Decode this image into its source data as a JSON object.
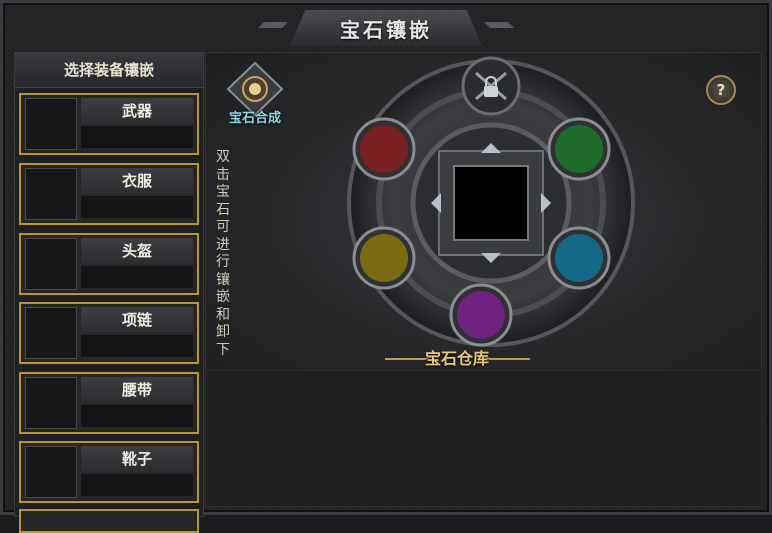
{
  "window": {
    "title": "宝石镶嵌"
  },
  "equipment": {
    "header": "选择装备镶嵌",
    "slots": [
      {
        "label": "武器"
      },
      {
        "label": "衣服"
      },
      {
        "label": "头盔"
      },
      {
        "label": "项链"
      },
      {
        "label": "腰带"
      },
      {
        "label": "靴子"
      }
    ]
  },
  "tools": {
    "synthesis_label": "宝石合成",
    "synthesis_icon": "gem-synthesis-icon",
    "help_label": "?"
  },
  "instructions": "双击宝石可进行镶嵌和卸下",
  "wheel": {
    "sockets": [
      {
        "name": "red-gem-socket",
        "color": "#7a1f22"
      },
      {
        "name": "green-gem-socket",
        "color": "#1f6b2a"
      },
      {
        "name": "yellow-gem-socket",
        "color": "#7a6a12"
      },
      {
        "name": "blue-gem-socket",
        "color": "#146a86"
      },
      {
        "name": "purple-gem-socket",
        "color": "#6e2280"
      }
    ],
    "lock_icon": "lock-icon"
  },
  "storage": {
    "title": "宝石仓库"
  }
}
